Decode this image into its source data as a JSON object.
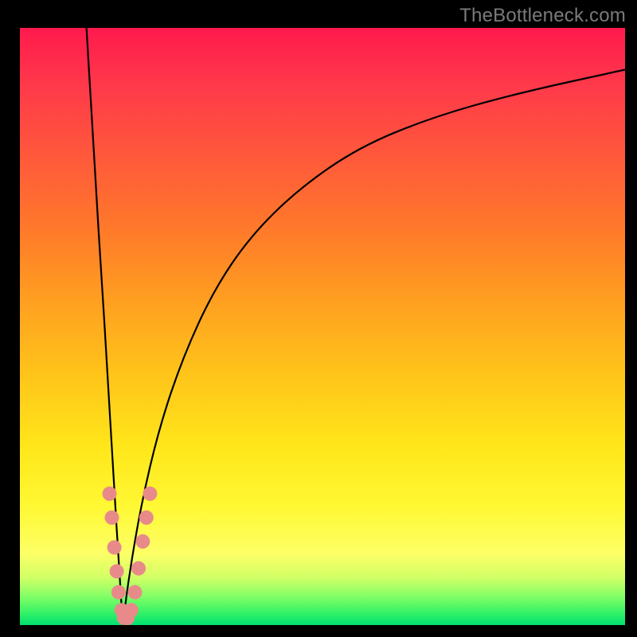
{
  "watermark": "TheBottleneck.com",
  "chart_data": {
    "type": "line",
    "title": "",
    "xlabel": "",
    "ylabel": "",
    "xlim": [
      0,
      100
    ],
    "ylim": [
      0,
      100
    ],
    "x_minimum": 17,
    "series": [
      {
        "name": "left-branch",
        "x": [
          11,
          12,
          13,
          14,
          15,
          16,
          17
        ],
        "values": [
          100,
          83,
          66,
          50,
          33,
          16,
          0
        ]
      },
      {
        "name": "right-branch",
        "x": [
          17,
          18,
          20,
          23,
          27,
          32,
          38,
          46,
          56,
          68,
          82,
          100
        ],
        "values": [
          0,
          8,
          20,
          33,
          45,
          56,
          65,
          73,
          80,
          85,
          89,
          93
        ]
      }
    ],
    "markers": {
      "name": "tolerance-band",
      "color": "#e88a8a",
      "points": [
        {
          "x": 14.8,
          "y": 22
        },
        {
          "x": 15.2,
          "y": 18
        },
        {
          "x": 15.6,
          "y": 13
        },
        {
          "x": 16.0,
          "y": 9
        },
        {
          "x": 16.3,
          "y": 5.5
        },
        {
          "x": 16.8,
          "y": 2.5
        },
        {
          "x": 17.2,
          "y": 1.2
        },
        {
          "x": 17.8,
          "y": 1.2
        },
        {
          "x": 18.4,
          "y": 2.5
        },
        {
          "x": 19.0,
          "y": 5.5
        },
        {
          "x": 19.6,
          "y": 9.5
        },
        {
          "x": 20.3,
          "y": 14
        },
        {
          "x": 20.9,
          "y": 18
        },
        {
          "x": 21.5,
          "y": 22
        }
      ]
    },
    "gradient_stops": [
      {
        "pos": 0.0,
        "color": "#ff1a4d"
      },
      {
        "pos": 0.5,
        "color": "#ffb020"
      },
      {
        "pos": 0.8,
        "color": "#fff040"
      },
      {
        "pos": 1.0,
        "color": "#00e070"
      }
    ]
  }
}
